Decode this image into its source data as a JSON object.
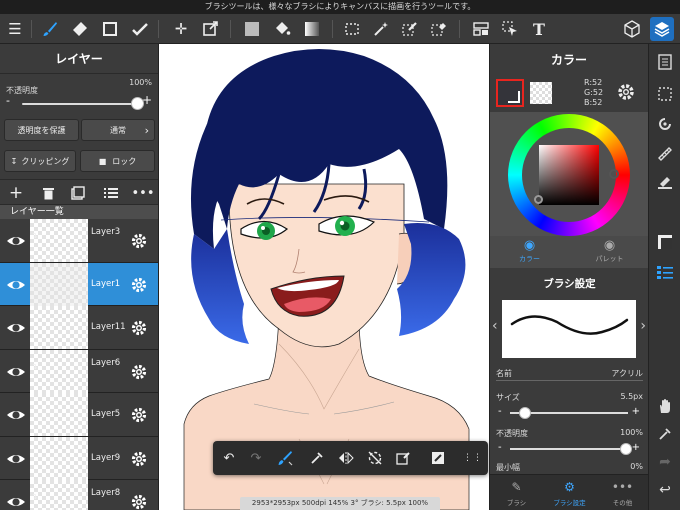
{
  "tooltip": "ブラシツールは、様々なブラシによりキャンバスに描画を行うツールです。",
  "toolbar": {
    "icons": [
      "menu-icon",
      "brush-icon",
      "eraser-icon",
      "rectangle-icon",
      "smudge-icon",
      "move-icon",
      "transform-icon",
      "fill-color-icon",
      "bucket-icon",
      "gradient-icon",
      "lasso-icon",
      "magic-wand-icon",
      "selection-pen-icon",
      "selection-eraser-icon",
      "panel-icon",
      "select-move-icon",
      "text-icon",
      "3d-icon",
      "layers-icon"
    ],
    "text_tool_label": "T"
  },
  "layer_panel": {
    "title": "レイヤー",
    "opacity_label": "不透明度",
    "opacity_value": "100%",
    "opacity_fraction": 1.0,
    "protect_transparency_label": "透明度を保護",
    "blend_mode_label": "通常",
    "clipping_label": "クリッピング",
    "lock_label": "ロック",
    "list_title": "レイヤー一覧",
    "layers": [
      {
        "name": "Layer3",
        "clipped": true,
        "selected": false,
        "wrap": true
      },
      {
        "name": "Layer1",
        "clipped": false,
        "selected": true,
        "wrap": false
      },
      {
        "name": "Layer11",
        "clipped": false,
        "selected": false,
        "wrap": false
      },
      {
        "name": "Layer6",
        "clipped": true,
        "selected": false,
        "wrap": true
      },
      {
        "name": "Layer5",
        "clipped": false,
        "selected": false,
        "wrap": false
      },
      {
        "name": "Layer9",
        "clipped": false,
        "selected": false,
        "wrap": false
      },
      {
        "name": "Layer8",
        "clipped": true,
        "selected": false,
        "wrap": true
      }
    ]
  },
  "canvas": {
    "status": "2953*2953px 500dpi 145% 3° ブラシ: 5.5px 100%"
  },
  "color_panel": {
    "title": "カラー",
    "r": "R:52",
    "g": "G:52",
    "b": "B:52",
    "current_color": "#34343a",
    "tab_color": "カラー",
    "tab_palette": "パレット"
  },
  "brush_panel": {
    "title": "ブラシ設定",
    "name_label": "名前",
    "name_value": "アクリル",
    "size_label": "サイズ",
    "size_value": "5.5px",
    "size_fraction": 0.05,
    "opacity_label": "不透明度",
    "opacity_value": "100%",
    "opacity_fraction": 1.0,
    "min_width_label": "最小幅",
    "min_width_value": "0%"
  },
  "bottom_tabs": {
    "brush": "ブラシ",
    "brush_settings": "ブラシ設定",
    "other": "その他"
  },
  "colors": {
    "accent": "#2ea3ff",
    "selected_layer": "#2f8fd8",
    "panel": "#3b3b3b"
  }
}
